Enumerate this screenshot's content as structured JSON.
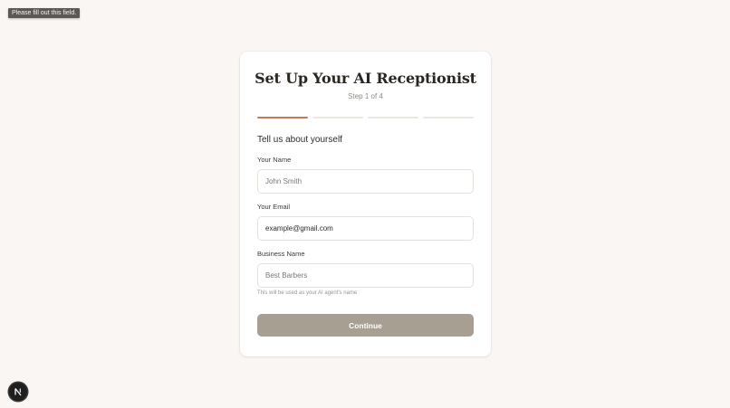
{
  "tooltip": {
    "text": "Please fill out this field."
  },
  "card": {
    "title": "Set Up Your AI Receptionist",
    "step_text": "Step 1 of 4",
    "progress": {
      "current_step": 1,
      "total_steps": 4
    },
    "section_title": "Tell us about yourself",
    "fields": {
      "name": {
        "label": "Your Name",
        "placeholder": "John Smith",
        "value": ""
      },
      "email": {
        "label": "Your Email",
        "placeholder": "example@gmail.com",
        "value": "example@gmail.com"
      },
      "business": {
        "label": "Business Name",
        "placeholder": "Best Barbers",
        "value": "",
        "hint": "This will be used as your AI agent's name"
      }
    },
    "continue_label": "Continue"
  },
  "dev_badge": {
    "icon": "nextjs-logo-icon",
    "letter": "N"
  },
  "colors": {
    "background": "#faf6f3",
    "accent": "#c67a57",
    "button": "#a69f92"
  }
}
